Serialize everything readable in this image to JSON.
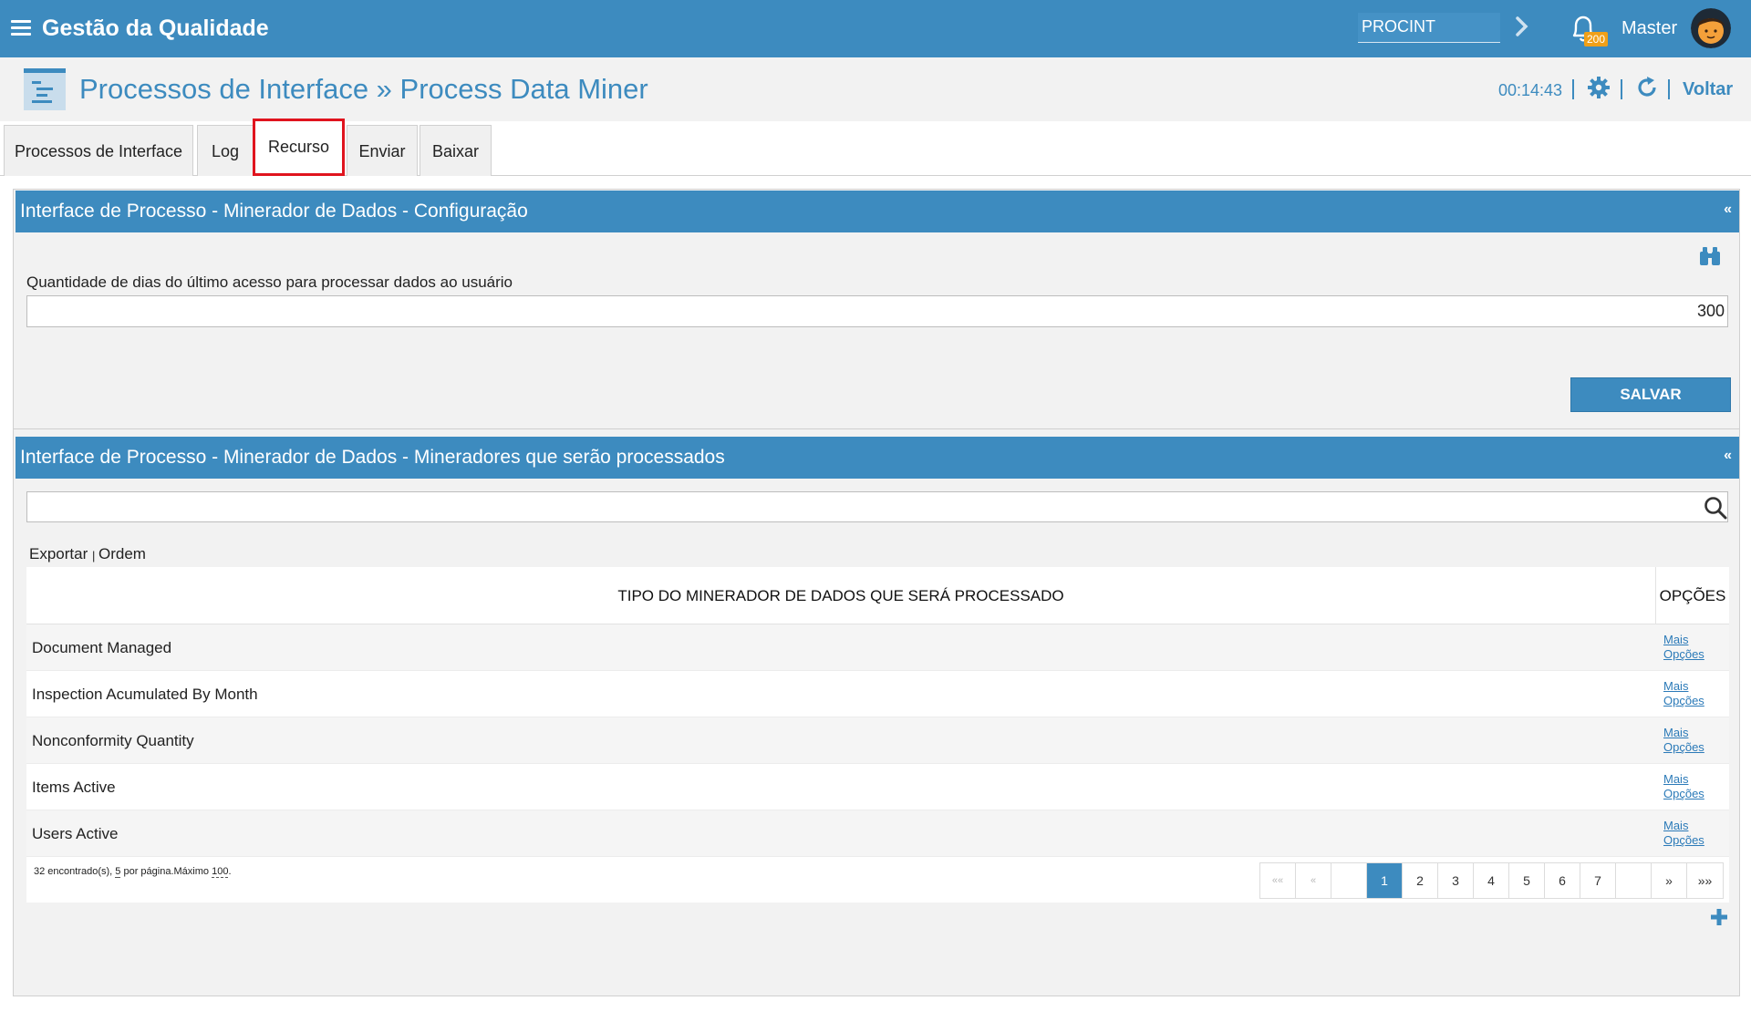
{
  "topbar": {
    "app_title": "Gestão da Qualidade",
    "module": "PROCINT",
    "notification_count": "200",
    "user_name": "Master"
  },
  "header": {
    "title": "Processos de Interface » Process Data Miner",
    "timer": "00:14:43",
    "back_label": "Voltar"
  },
  "tabs": [
    {
      "label": "Processos de Interface"
    },
    {
      "label": "Log"
    },
    {
      "label": "Recurso"
    },
    {
      "label": "Enviar"
    },
    {
      "label": "Baixar"
    }
  ],
  "config_panel": {
    "title": "Interface de Processo - Minerador de Dados - Configuração",
    "collapse": "«",
    "field_label": "Quantidade de dias do último acesso para processar dados ao usuário",
    "field_value": "300",
    "save_label": "SALVAR"
  },
  "miners_panel": {
    "title": "Interface de Processo - Minerador de Dados - Mineradores que serão processados",
    "collapse": "«",
    "search_value": "",
    "export_label": "Exportar",
    "separator": "|",
    "order_label": "Ordem",
    "columns": {
      "type": "TIPO DO MINERADOR DE DADOS QUE SERÁ PROCESSADO",
      "options": "OPÇÕES"
    },
    "option_link": {
      "line1": "Mais",
      "line2": "Opções"
    },
    "rows": [
      {
        "name": "Document Managed"
      },
      {
        "name": "Inspection Acumulated By Month"
      },
      {
        "name": "Nonconformity Quantity"
      },
      {
        "name": "Items Active"
      },
      {
        "name": "Users Active"
      }
    ],
    "footer": {
      "found": "32",
      "found_suffix": " encontrado(s), ",
      "per_page": "5",
      "per_page_suffix": " por página.Máximo ",
      "max": "100",
      "end": "."
    },
    "pagination": {
      "first": "««",
      "prev": "«",
      "pages": [
        "1",
        "2",
        "3",
        "4",
        "5",
        "6",
        "7"
      ],
      "current": "1",
      "next": "»",
      "last": "»»"
    }
  },
  "colors": {
    "primary": "#3d8bbf",
    "active_tab_border": "#e0141e",
    "badge": "#f0a018",
    "panel_bg": "#f2f2f2"
  },
  "icons": [
    "menu-icon",
    "chevron-right-icon",
    "bell-icon",
    "user-avatar",
    "list-page-icon",
    "gear-icon",
    "refresh-icon",
    "binoculars-icon",
    "search-icon",
    "plus-icon"
  ]
}
